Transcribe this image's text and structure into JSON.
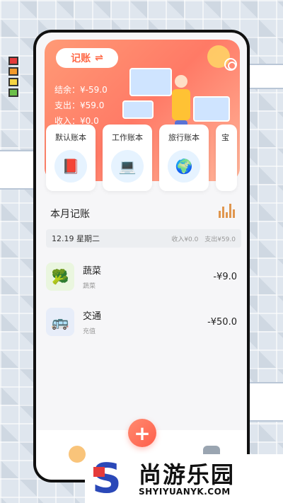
{
  "header": {
    "record_label": "记账",
    "record_icon": "swap-arrows-icon",
    "balance_label": "结余",
    "balance_value": "¥-59.0",
    "expense_label": "支出",
    "expense_value": "¥59.0",
    "income_label": "收入",
    "income_value": "¥0.0"
  },
  "books": [
    {
      "label": "默认账本",
      "icon": "book-money-icon",
      "glyph": "📕"
    },
    {
      "label": "工作账本",
      "icon": "computer-icon",
      "glyph": "💻"
    },
    {
      "label": "旅行账本",
      "icon": "globe-plane-icon",
      "glyph": "🌍"
    },
    {
      "label": "宝",
      "icon": "partial-book-icon",
      "glyph": ""
    }
  ],
  "section": {
    "title": "本月记账"
  },
  "day": {
    "date": "12.19 星期二",
    "income": "收入¥0.0",
    "expense": "支出¥59.0"
  },
  "entries": [
    {
      "name": "蔬菜",
      "note": "蔬菜",
      "amount": "-¥9.0",
      "icon": "vegetables-icon",
      "glyph": "🥦",
      "bg": "#eaf6df"
    },
    {
      "name": "交通",
      "note": "充值",
      "amount": "-¥50.0",
      "icon": "bus-icon",
      "glyph": "🚌",
      "bg": "#e7edf9"
    }
  ],
  "tabbar": {
    "fab_label": "+"
  },
  "watermark": {
    "cn": "尚游乐园",
    "en": "SHYIYUANYK.COM",
    "logo": "S"
  },
  "colors": {
    "accent": "#ff6b4a",
    "hero_start": "#ff9a76",
    "hero_end": "#ffb59a"
  }
}
